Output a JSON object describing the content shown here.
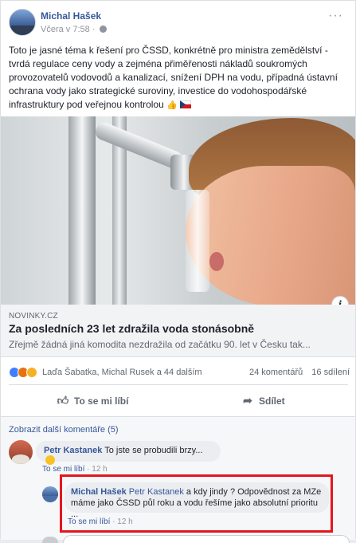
{
  "post": {
    "author": "Michal Hašek",
    "time": "Včera v 7:58",
    "meta_sep": "·",
    "text": "Toto je jasné téma k řešení pro ČSSD, konkrétně pro ministra zemědělství - tvrdá regulace ceny vody a zejména přiměřenosti nákladů soukromých provozovatelů vodovodů a kanalizací, snížení DPH na vodu, případná ústavní ochrana vody jako strategické suroviny, investice do vodohospodářské infrastruktury pod veřejnou kontrolou",
    "emoji": "👍",
    "icons": {
      "more": "more-options-icon",
      "privacy": "globe-icon",
      "flag": "czech-flag"
    }
  },
  "link": {
    "domain": "NOVINKY.CZ",
    "title": "Za posledních 23 let zdražila voda stonásobně",
    "description": "Zřejmě žádná jiná komodita nezdražila od začátku 90. let v Česku tak...",
    "info_icon": "i"
  },
  "stats": {
    "reactions": [
      "like",
      "angry",
      "haha"
    ],
    "names": "Laďa Šabatka, Michal Rusek a 44 dalším",
    "comments": "24 komentářů",
    "shares": "16 sdílení"
  },
  "actions": {
    "like": "To se mi líbí",
    "share": "Sdílet"
  },
  "comments": {
    "more_label": "Zobrazit další komentáře (5)",
    "items": [
      {
        "author": "Petr Kastanek",
        "text": "To jste se probudili brzy...",
        "like_label": "To se mi líbí",
        "sep": "·",
        "time": "12 h"
      },
      {
        "author": "Michal Hašek",
        "tag": "Petr Kastanek",
        "text": "a kdy jindy ? Odpovědnost za MZe máme jako ČSSD půl roku a vodu řešíme jako absolutní prioritu ...",
        "like_label": "To se mi líbí",
        "sep": "·",
        "time": "12 h"
      }
    ]
  },
  "colors": {
    "link_blue": "#365899",
    "highlight_red": "#e3161e",
    "like_blue": "#4080ff"
  }
}
